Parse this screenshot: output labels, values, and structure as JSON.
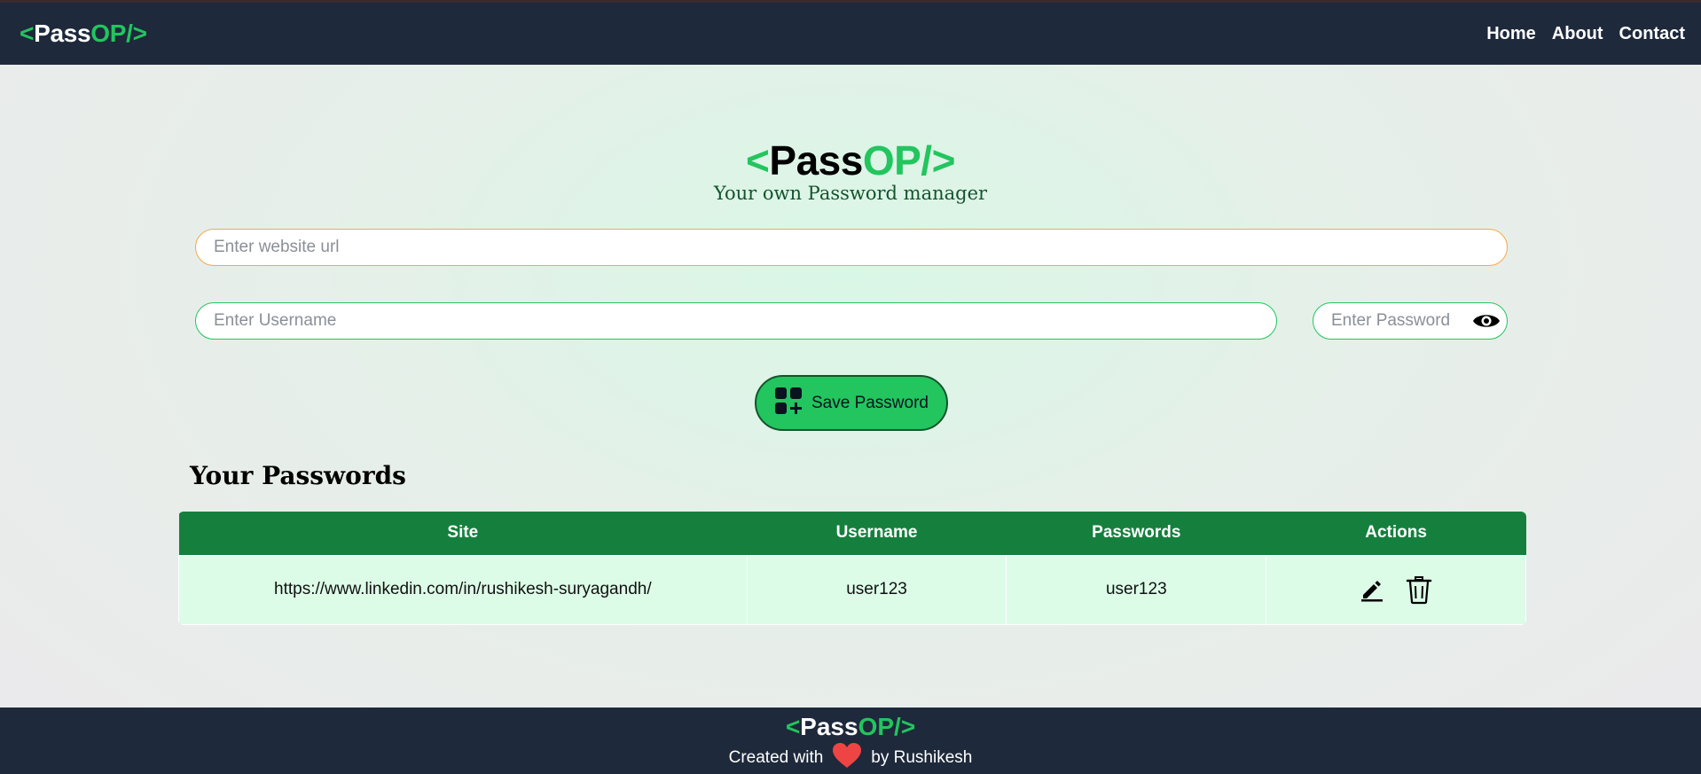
{
  "nav": {
    "logo": {
      "open": "<",
      "pass": "Pass",
      "op": "OP/>"
    },
    "links": [
      "Home",
      "About",
      "Contact"
    ]
  },
  "hero": {
    "logo": {
      "open": "<",
      "pass": "Pass",
      "op": "OP/>"
    },
    "tagline": "Your own Password manager"
  },
  "form": {
    "url_placeholder": "Enter website url",
    "username_placeholder": "Enter Username",
    "password_placeholder": "Enter Password",
    "save_label": "Save Password"
  },
  "passwords": {
    "title": "Your Passwords",
    "headers": [
      "Site",
      "Username",
      "Passwords",
      "Actions"
    ],
    "rows": [
      {
        "site": "https://www.linkedin.com/in/rushikesh-suryagandh/",
        "username": "user123",
        "password": "user123"
      }
    ]
  },
  "footer": {
    "logo": {
      "open": "<",
      "pass": "Pass",
      "op": "OP/>"
    },
    "created_with": "Created with",
    "by": "by Rushikesh"
  },
  "colors": {
    "brand_green": "#22c55e",
    "nav_bg": "#1e293b",
    "table_header": "#15803d",
    "table_row": "#dcfce7",
    "heart": "#ef4444"
  }
}
